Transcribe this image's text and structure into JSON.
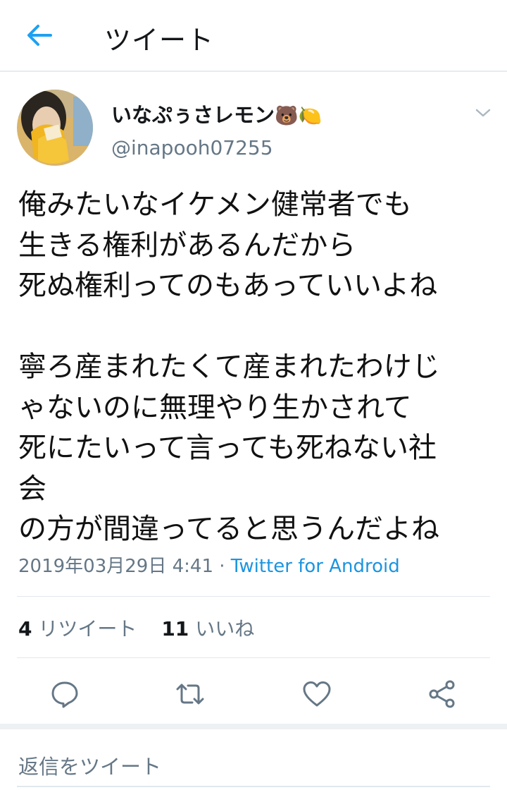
{
  "header": {
    "title": "ツイート",
    "back_icon": "back-arrow-icon"
  },
  "tweet": {
    "display_name": "いなぷぅさレモン",
    "name_emojis": "🐻🍋",
    "handle": "@inapooh07255",
    "text": "俺みたいなイケメン健常者でも\n生きる権利があるんだから\n死ぬ権利ってのもあっていいよね\n\n寧ろ産まれたくて産まれたわけじ\nゃないのに無理やり生かされて\n死にたいって言っても死ねない社\n会\nの方が間違ってると思うんだよね",
    "timestamp": "2019年03月29日 4:41",
    "separator": " · ",
    "source": "Twitter for Android",
    "retweet_count": "4",
    "retweet_label": "リツイート",
    "like_count": "11",
    "like_label": "いいね"
  },
  "actions": [
    "reply-icon",
    "retweet-icon",
    "like-icon",
    "share-icon"
  ],
  "reply": {
    "placeholder": "返信をツイート"
  },
  "colors": {
    "accent": "#1da1f2",
    "link": "#1b95e0",
    "muted": "#657786",
    "divider": "#e1e8ed"
  }
}
